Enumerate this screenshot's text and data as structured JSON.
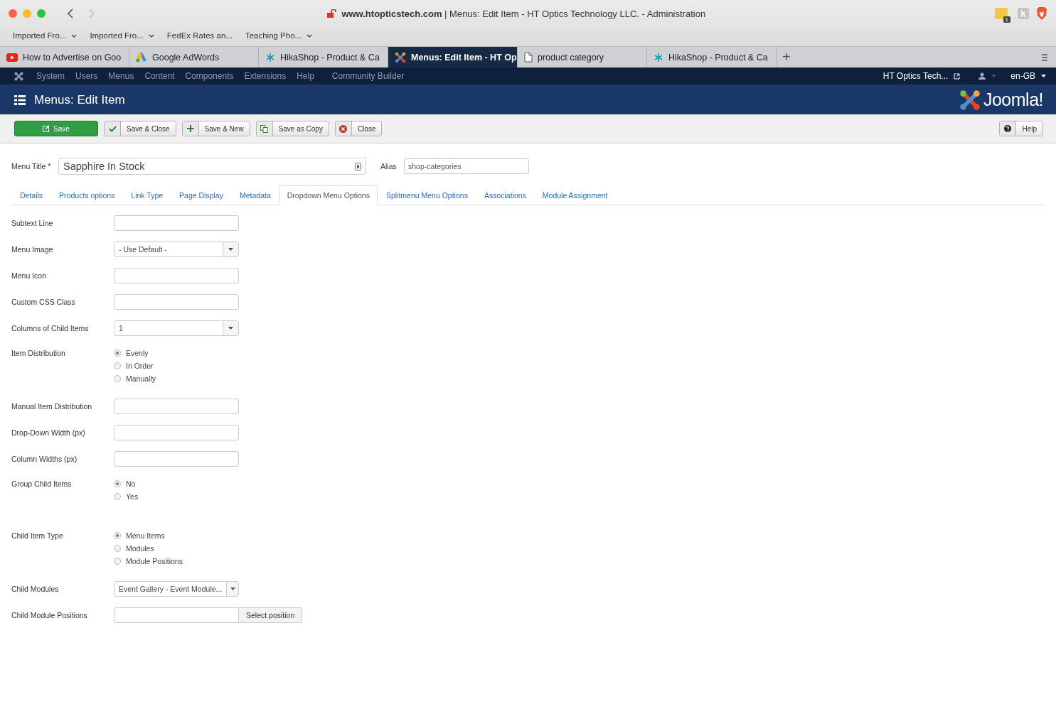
{
  "browser": {
    "address": "**www.htopticstech.com** | Menus: Edit Item - HT Optics Technology LLC. - Administration",
    "extension_badge": "1",
    "bookmarks": [
      {
        "label": "Imported Fro...",
        "has_menu": true
      },
      {
        "label": "Imported Fro...",
        "has_menu": true
      },
      {
        "label": "FedEx Rates an...",
        "has_menu": false
      },
      {
        "label": "Teaching Pho...",
        "has_menu": true
      }
    ],
    "tabs": [
      {
        "label": "How to Advertise on Goo",
        "kind": "video",
        "selected": false
      },
      {
        "label": "Google AdWords",
        "kind": "ads",
        "selected": false
      },
      {
        "label": "HikaShop - Product & Ca",
        "kind": "shop",
        "selected": false
      },
      {
        "label": "Menus: Edit Item - HT Op",
        "kind": "cms",
        "selected": true
      },
      {
        "label": "product category",
        "kind": "page",
        "selected": false
      },
      {
        "label": "HikaShop - Product & Ca",
        "kind": "shop",
        "selected": false
      }
    ],
    "new_tab": "+"
  },
  "admin_menu": {
    "items": [
      "System",
      "Users",
      "Menus",
      "Content",
      "Components",
      "Extensions",
      "Help",
      "Community Builder"
    ],
    "site": "HT Optics Tech...",
    "language": "en-GB"
  },
  "header": {
    "title": "Menus: Edit Item",
    "logo": "Joomla!"
  },
  "toolbar": {
    "buttons": [
      {
        "label": "Save",
        "kind": "primary"
      },
      {
        "label": "Save & Close",
        "kind": "check"
      },
      {
        "label": "Save & New",
        "kind": "plus"
      },
      {
        "label": "Save as Copy",
        "kind": "copy"
      },
      {
        "label": "Close",
        "kind": "close"
      }
    ],
    "help": "Help"
  },
  "form": {
    "title_label": "Menu Title *",
    "title_value": "Sapphire In Stock",
    "alias_label": "Alias",
    "alias_value": "shop-categories",
    "tabs": [
      {
        "label": "Details",
        "selected": false
      },
      {
        "label": "Products options",
        "selected": false
      },
      {
        "label": "Link Type",
        "selected": false
      },
      {
        "label": "Page Display",
        "selected": false
      },
      {
        "label": "Metadata",
        "selected": false
      },
      {
        "label": "Dropdown Menu Options",
        "selected": true
      },
      {
        "label": "Splitmenu Menu Options",
        "selected": false
      },
      {
        "label": "Associations",
        "selected": false
      },
      {
        "label": "Module Assignment",
        "selected": false
      }
    ],
    "fields": [
      {
        "kind": "text",
        "label": "Subtext Line"
      },
      {
        "kind": "select",
        "label": "Menu Image",
        "value": "- Use Default -"
      },
      {
        "kind": "text",
        "label": "Menu Icon"
      },
      {
        "kind": "text",
        "label": "Custom CSS Class"
      },
      {
        "kind": "select",
        "label": "Columns of Child Items",
        "value": "1"
      },
      {
        "kind": "radio",
        "label": "Item Distribution",
        "options": [
          {
            "label": "Evenly",
            "selected": true
          },
          {
            "label": "In Order",
            "selected": false
          },
          {
            "label": "Manually",
            "selected": false
          }
        ]
      },
      {
        "kind": "text",
        "label": "Manual Item Distribution"
      },
      {
        "kind": "text",
        "label": "Drop-Down Width (px)"
      },
      {
        "kind": "text",
        "label": "Column Widths (px)"
      },
      {
        "kind": "radio",
        "label": "Group Child Items",
        "options": [
          {
            "label": "No",
            "selected": true
          },
          {
            "label": "Yes",
            "selected": false
          }
        ]
      },
      {
        "kind": "radio",
        "label": "Child Item Type",
        "options": [
          {
            "label": "Menu Items",
            "selected": true
          },
          {
            "label": "Modules",
            "selected": false
          },
          {
            "label": "Module Positions",
            "selected": false
          }
        ]
      },
      {
        "kind": "select",
        "label": "Child Modules",
        "value": "Event Gallery - Event Module..."
      },
      {
        "kind": "position",
        "label": "Child Module Positions",
        "button": "Select position"
      }
    ]
  }
}
